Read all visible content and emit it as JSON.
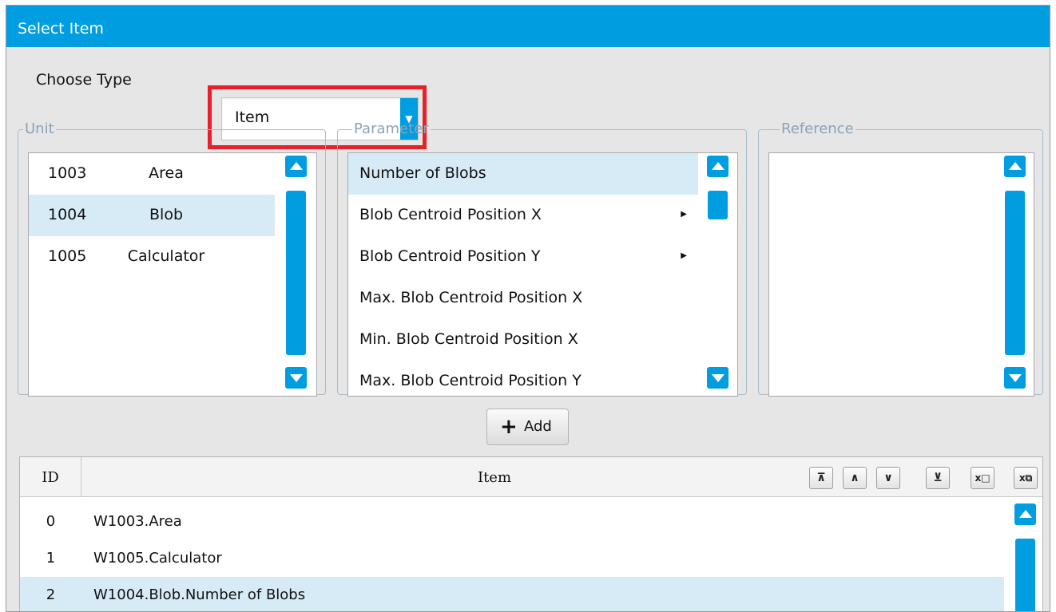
{
  "window": {
    "title": "Select Item"
  },
  "choose_type": {
    "label": "Choose Type",
    "value": "Item"
  },
  "unit": {
    "legend": "Unit",
    "rows": [
      {
        "id": "1003",
        "name": "Area",
        "selected": false
      },
      {
        "id": "1004",
        "name": "Blob",
        "selected": true
      },
      {
        "id": "1005",
        "name": "Calculator",
        "selected": false
      }
    ]
  },
  "parameter": {
    "legend": "Parameter",
    "rows": [
      {
        "label": "Number of Blobs",
        "submenu": false,
        "selected": true
      },
      {
        "label": "Blob Centroid Position X",
        "submenu": true,
        "selected": false
      },
      {
        "label": "Blob Centroid Position Y",
        "submenu": true,
        "selected": false
      },
      {
        "label": "Max. Blob Centroid Position X",
        "submenu": false,
        "selected": false
      },
      {
        "label": "Min. Blob Centroid Position X",
        "submenu": false,
        "selected": false
      },
      {
        "label": "Max. Blob Centroid Position Y",
        "submenu": false,
        "selected": false
      }
    ]
  },
  "reference": {
    "legend": "Reference",
    "rows": []
  },
  "add_button": {
    "icon": "plus-icon",
    "label": "Add"
  },
  "table": {
    "headers": {
      "id": "ID",
      "item": "Item"
    },
    "toolbar": [
      "move-top-icon",
      "move-up-icon",
      "move-down-icon",
      "move-bottom-icon",
      "delete-icon",
      "delete-all-icon"
    ],
    "rows": [
      {
        "id": "0",
        "item": "W1003.Area",
        "selected": false
      },
      {
        "id": "1",
        "item": "W1005.Calculator",
        "selected": false
      },
      {
        "id": "2",
        "item": "W1004.Blob.Number of Blobs",
        "selected": true
      }
    ]
  },
  "colors": {
    "accent": "#009ee0",
    "highlight": "#e8202a",
    "selection": "#d7ebf7"
  }
}
